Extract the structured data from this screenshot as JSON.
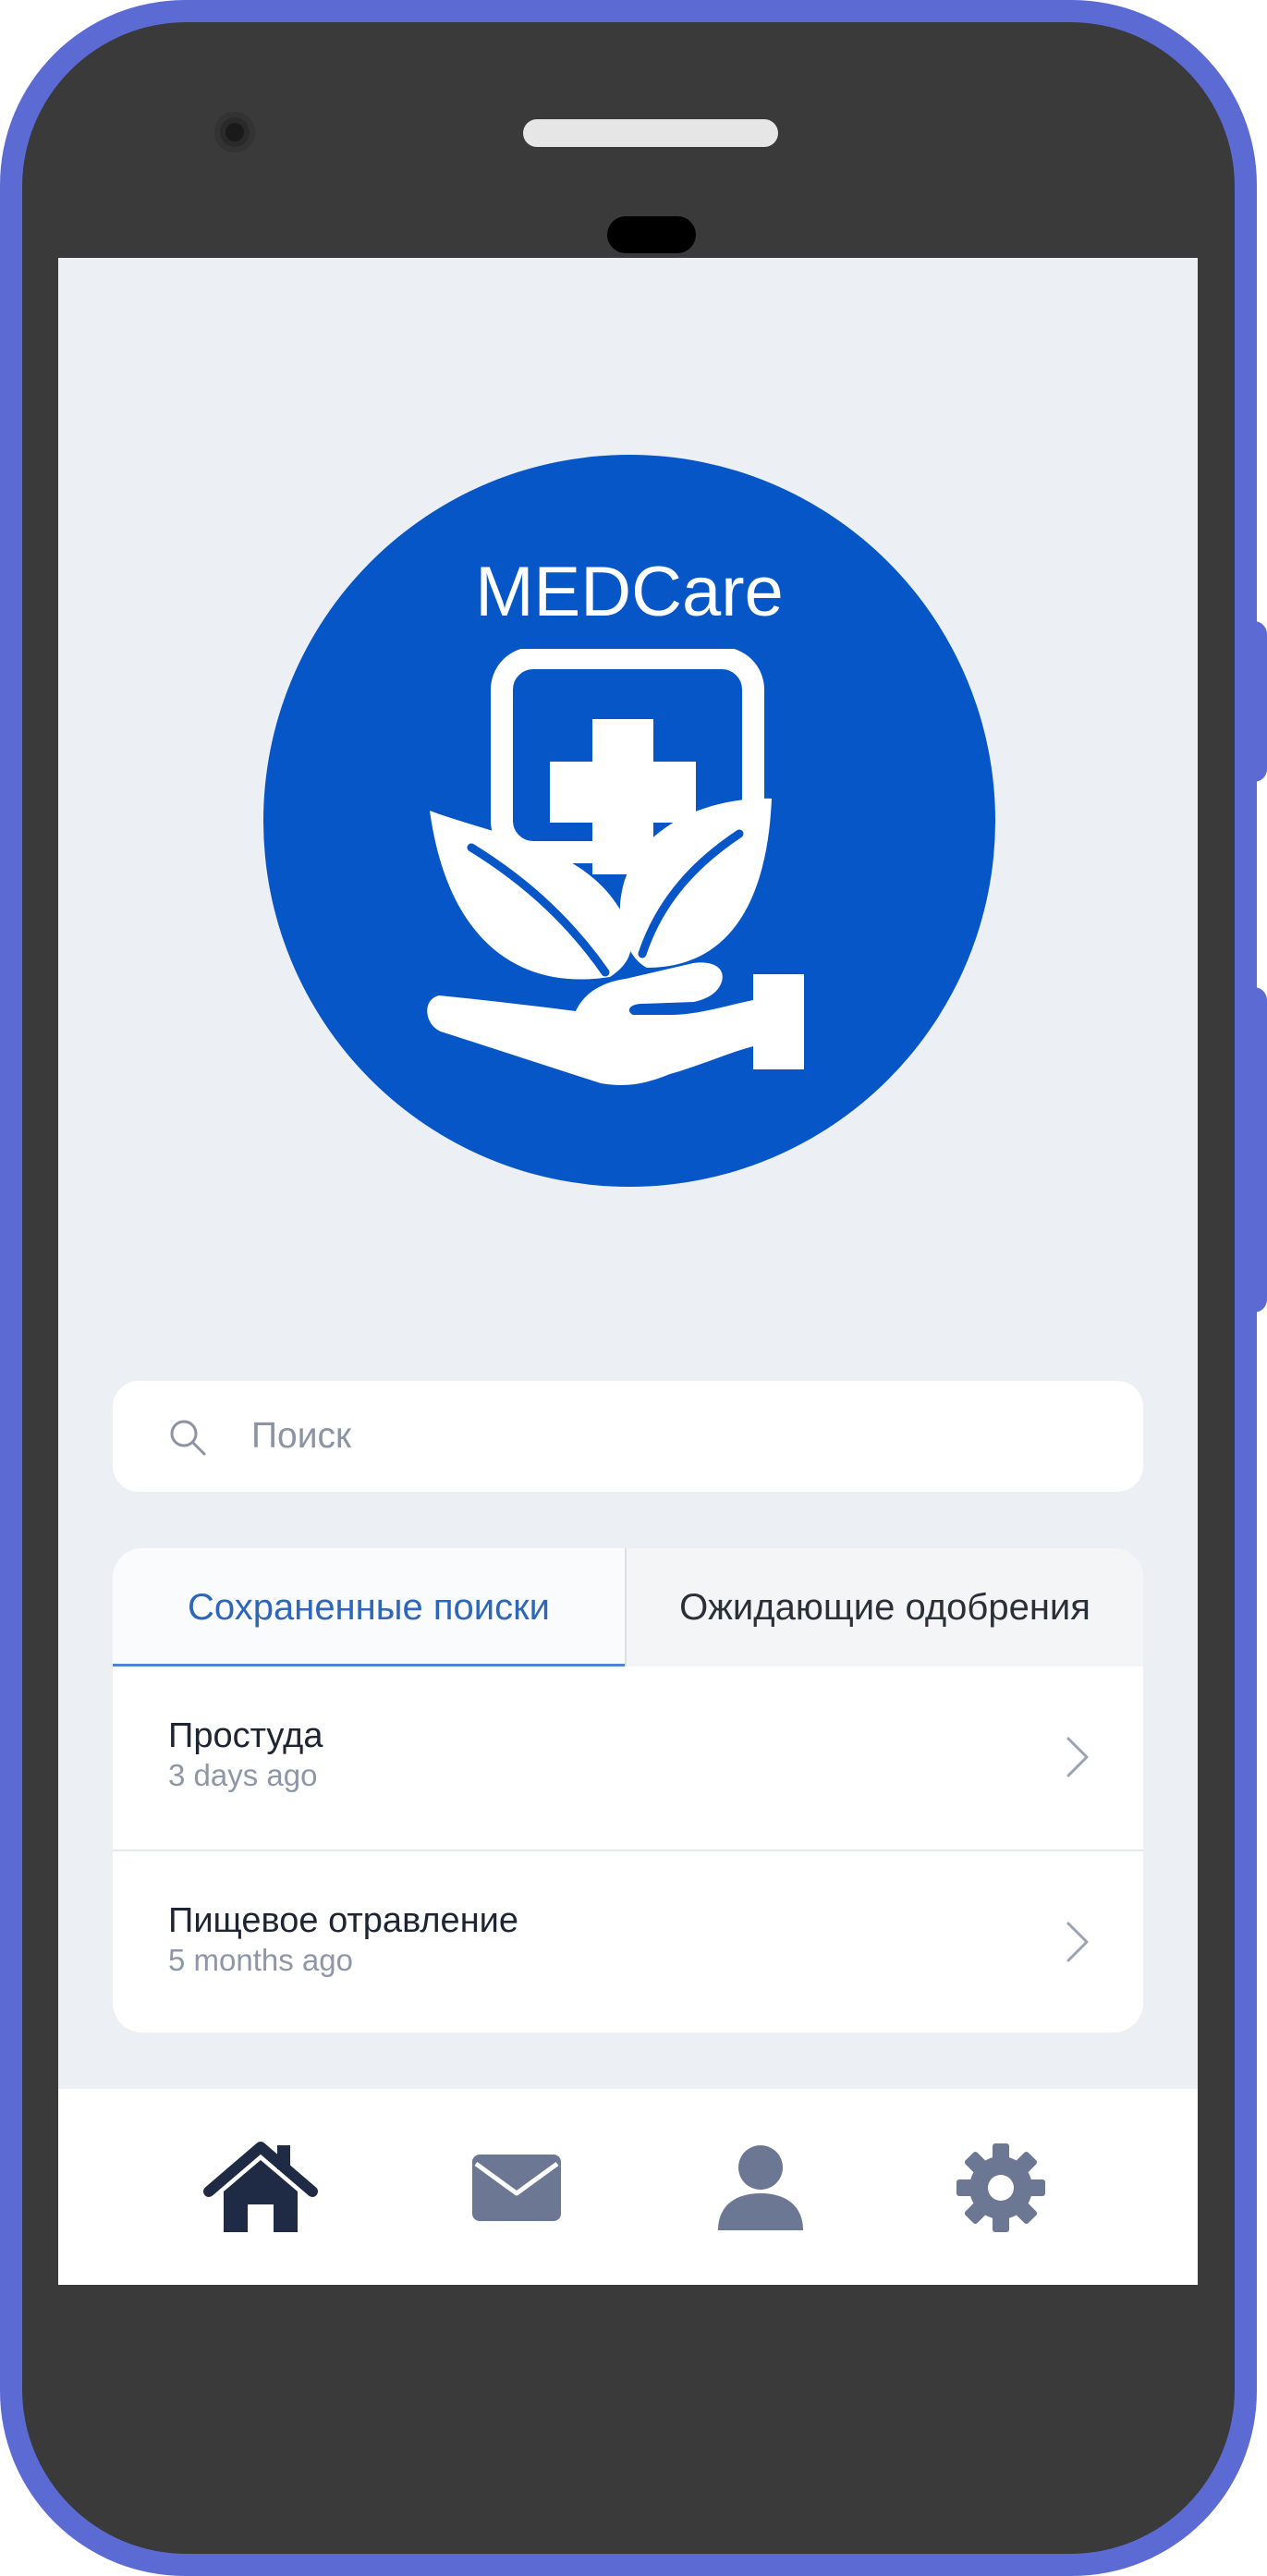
{
  "app": {
    "logo_title": "MEDCare"
  },
  "search": {
    "placeholder": "Поиск",
    "value": ""
  },
  "tabs": [
    {
      "label": "Сохраненные поиски",
      "active": true
    },
    {
      "label": "Ожидающие одобрения",
      "active": false
    }
  ],
  "saved_searches": [
    {
      "title": "Простуда",
      "time": "3 days ago"
    },
    {
      "title": "Пищевое отравление",
      "time": "5 months ago"
    }
  ],
  "bottom_nav": [
    {
      "name": "home",
      "icon": "home-icon",
      "active": true
    },
    {
      "name": "messages",
      "icon": "mail-icon",
      "active": false
    },
    {
      "name": "profile",
      "icon": "user-icon",
      "active": false
    },
    {
      "name": "settings",
      "icon": "gear-icon",
      "active": false
    }
  ],
  "colors": {
    "brand": "#0656c8",
    "tab_active_text": "#2e67b9",
    "phone_frame": "#5c6bd4",
    "nav_active": "#1f2a44",
    "nav_inactive": "#6c7893"
  }
}
